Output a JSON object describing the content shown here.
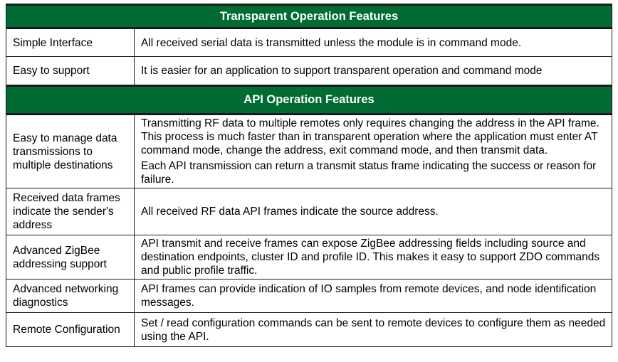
{
  "sections": [
    {
      "title": "Transparent Operation Features",
      "rows": [
        {
          "feature": "Simple Interface",
          "description": [
            "All received serial data is transmitted unless the module is in command mode."
          ]
        },
        {
          "feature": "Easy to support",
          "description": [
            "It is easier for an application to support transparent operation and command mode"
          ]
        }
      ]
    },
    {
      "title": "API Operation Features",
      "rows": [
        {
          "feature": "Easy to manage data transmissions to multiple destinations",
          "description": [
            "Transmitting RF data to multiple remotes only requires changing the address in the API frame. This process is much faster than in transparent operation where the application must enter AT command mode, change the address, exit command mode, and then transmit data.",
            "Each API transmission can return a transmit status frame indicating the success or reason for failure."
          ]
        },
        {
          "feature": "Received data frames indicate the sender's address",
          "description": [
            "All received RF data API frames indicate the source address."
          ]
        },
        {
          "feature": "Advanced ZigBee addressing support",
          "description": [
            "API transmit and receive frames can expose ZigBee addressing fields including source and destination endpoints, cluster ID and profile ID. This makes it easy to support ZDO commands and public profile traffic."
          ]
        },
        {
          "feature": "Advanced networking diagnostics",
          "description": [
            "API frames can provide indication of IO samples from remote devices, and node identification messages."
          ]
        },
        {
          "feature": "Remote Configuration",
          "description": [
            "Set / read configuration commands can be sent to remote devices to configure them as needed using the API."
          ]
        }
      ]
    }
  ]
}
